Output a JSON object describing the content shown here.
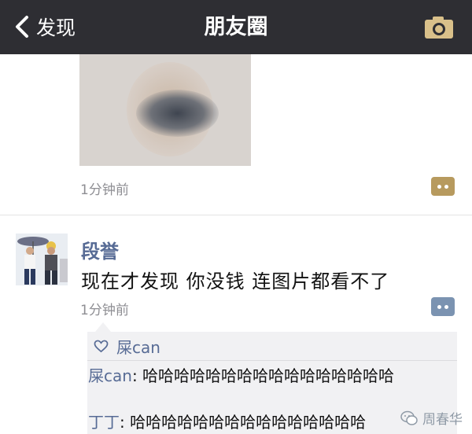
{
  "navbar": {
    "back_label": "发现",
    "title": "朋友圈"
  },
  "post1": {
    "time": "1分钟前"
  },
  "post2": {
    "author": "段誉",
    "text": "现在才发现 你没钱 连图片都看不了",
    "time": "1分钟前",
    "likes": [
      "屎can"
    ],
    "comments": [
      {
        "name": "屎can",
        "separator": ": ",
        "text": "哈哈哈哈哈哈哈哈哈哈哈哈哈哈哈哈"
      },
      {
        "name": "丁丁",
        "separator": ": ",
        "text": "哈哈哈哈哈哈哈哈哈哈哈哈哈哈哈"
      }
    ]
  },
  "watermark": {
    "text": "周春华"
  },
  "colors": {
    "navbar": "#2e2e33",
    "link": "#576b95",
    "comment_button_post1": "#b79a5e",
    "comment_button_post2": "#7b93b1"
  }
}
